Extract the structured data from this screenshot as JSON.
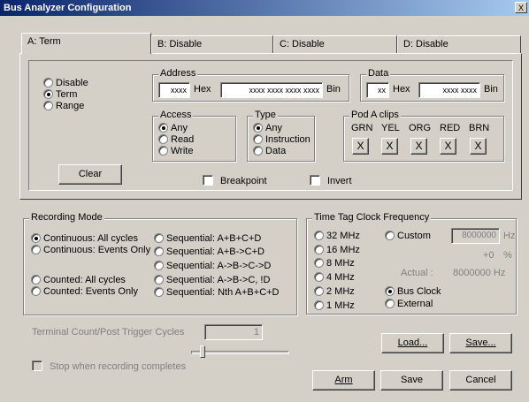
{
  "window": {
    "title": "Bus Analyzer Configuration",
    "close_glyph": "X"
  },
  "tabs": [
    {
      "label": "A:   Term"
    },
    {
      "label": "B:   Disable"
    },
    {
      "label": "C:   Disable"
    },
    {
      "label": "D:   Disable"
    }
  ],
  "mode": {
    "options": [
      "Disable",
      "Term",
      "Range"
    ],
    "selected": "Term"
  },
  "address": {
    "legend": "Address",
    "hex_value": "xxxx",
    "hex_label": "Hex",
    "bin_value": "xxxx xxxx xxxx xxxx",
    "bin_label": "Bin"
  },
  "data": {
    "legend": "Data",
    "hex_value": "xx",
    "hex_label": "Hex",
    "bin_value": "xxxx xxxx",
    "bin_label": "Bin"
  },
  "access": {
    "legend": "Access",
    "options": [
      "Any",
      "Read",
      "Write"
    ],
    "selected": "Any"
  },
  "type": {
    "legend": "Type",
    "options": [
      "Any",
      "Instruction",
      "Data"
    ],
    "selected": "Any"
  },
  "pod": {
    "legend": "Pod A clips",
    "clips": [
      "GRN",
      "YEL",
      "ORG",
      "RED",
      "BRN"
    ],
    "clip_value": "X"
  },
  "clear_label": "Clear",
  "breakpoint_label": "Breakpoint",
  "invert_label": "Invert",
  "recording": {
    "legend": "Recording Mode",
    "left_options": [
      "Continuous: All cycles",
      "Continuous: Events Only",
      "Counted: All cycles",
      "Counted: Events Only"
    ],
    "right_options": [
      "Sequential: A+B+C+D",
      "Sequential: A+B->C+D",
      "Sequential: A->B->C->D",
      "Sequential: A->B->C, !D",
      "Sequential: Nth A+B+C+D"
    ],
    "selected": "Continuous: All cycles",
    "terminal_label": "Terminal Count/Post Trigger Cycles",
    "terminal_value": "1",
    "stop_label": "Stop when recording completes"
  },
  "clock": {
    "legend": "Time Tag Clock Frequency",
    "left_options": [
      "32 MHz",
      "16 MHz",
      "8 MHz",
      "4 MHz",
      "2 MHz",
      "1 MHz"
    ],
    "selected": "32 MHz",
    "custom_label": "Custom",
    "custom_value": "8000000",
    "custom_unit": "Hz",
    "pct_value": "+0",
    "pct_unit": "%",
    "actual_label": "Actual :",
    "actual_value": "8000000 Hz",
    "bus_clock_label": "Bus Clock",
    "bus_clock_selected": true,
    "external_label": "External"
  },
  "buttons": {
    "load": "Load...",
    "save_as": "Save...",
    "arm": "Arm",
    "save": "Save",
    "cancel": "Cancel"
  }
}
